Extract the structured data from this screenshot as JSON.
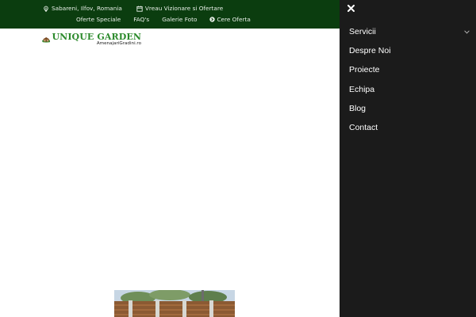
{
  "topbar": {
    "location": "Sabareni, Ilfov, Romania",
    "visit": "Vreau Vizionare si Ofertare",
    "links": [
      "Oferte Speciale",
      "FAQ's",
      "Galerie Foto"
    ],
    "cta": "Cere Oferta",
    "bg_color": "#0b3d0f"
  },
  "logo": {
    "brand": "UNIQUE GARDEN",
    "sub": "AmenajariGradini.ro",
    "brand_color": "#2c8a2c"
  },
  "side_menu": {
    "items": [
      "Servicii",
      "Despre Noi",
      "Proiecte",
      "Echipa",
      "Blog",
      "Contact"
    ],
    "bg_color": "#1b1b1b"
  }
}
